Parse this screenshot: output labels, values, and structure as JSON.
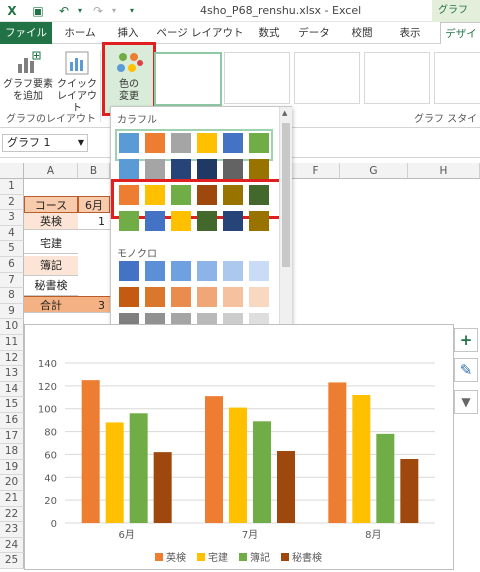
{
  "window": {
    "title": "4sho_P68_renshu.xlsx - Excel",
    "context_tab_group": "グラフ"
  },
  "tabs": [
    "ファイル",
    "ホーム",
    "挿入",
    "ページ レイアウト",
    "数式",
    "データ",
    "校閲",
    "表示",
    "デザイン"
  ],
  "ribbon": {
    "add_element_label_1": "グラフ要素",
    "add_element_label_2": "を追加",
    "quick_layout_label_1": "クイック",
    "quick_layout_label_2": "レイアウト",
    "change_colors_label_1": "色の",
    "change_colors_label_2": "変更",
    "group_layout": "グラフのレイアウト",
    "group_style": "グラフ スタイル"
  },
  "name_box": {
    "value": "グラフ 1"
  },
  "columns": [
    "A",
    "B",
    "F",
    "G",
    "H"
  ],
  "rows": [
    "1",
    "2",
    "3",
    "4",
    "5",
    "6",
    "7",
    "8",
    "9",
    "10",
    "11",
    "12",
    "13",
    "14",
    "15",
    "16",
    "17",
    "18",
    "19",
    "20",
    "21",
    "22",
    "23",
    "24",
    "25"
  ],
  "table": {
    "header": [
      "コース",
      "6月"
    ],
    "labels": [
      "英検",
      "宅建",
      "簿記",
      "秘書検",
      "合計"
    ],
    "partial_b": [
      "1",
      "",
      "",
      "",
      "3"
    ]
  },
  "dropdown": {
    "section_colorful": "カラフル",
    "section_mono": "モノクロ",
    "colorful_rows": [
      [
        "#5b9bd5",
        "#ed7d31",
        "#a5a5a5",
        "#ffc000",
        "#4472c4",
        "#70ad47"
      ],
      [
        "#5b9bd5",
        "#a5a5a5",
        "#264478",
        "#1f3864",
        "#636363",
        "#997300"
      ],
      [
        "#ed7d31",
        "#ffc000",
        "#70ad47",
        "#9e480e",
        "#997300",
        "#43682b"
      ],
      [
        "#70ad47",
        "#4472c4",
        "#ffc000",
        "#43682b",
        "#264478",
        "#997300"
      ]
    ],
    "mono_rows": [
      [
        "#4472c4",
        "#5b8fd6",
        "#6fa1e0",
        "#8db4e8",
        "#adc8ef",
        "#cadbf5"
      ],
      [
        "#c55a11",
        "#d9772d",
        "#e88d4f",
        "#f0a677",
        "#f6c19f",
        "#f9d8c2"
      ],
      [
        "#7f7f7f",
        "#919191",
        "#a5a5a5",
        "#b9b9b9",
        "#cccccc",
        "#dedede"
      ],
      [
        "#d39a00",
        "#e5ad17",
        "#f2be3b",
        "#f7ce6a",
        "#f9dd98",
        "#fce9c0"
      ],
      [
        "#2f5597",
        "#3b68b5",
        "#4d7ecb",
        "#6e97d6",
        "#95b4e2",
        "#bccfee"
      ]
    ]
  },
  "chart_data": {
    "type": "bar",
    "categories": [
      "6月",
      "7月",
      "8月"
    ],
    "series": [
      {
        "name": "英検",
        "color": "#ed7d31",
        "values": [
          125,
          111,
          123
        ]
      },
      {
        "name": "宅建",
        "color": "#ffc000",
        "values": [
          88,
          101,
          112
        ]
      },
      {
        "name": "簿記",
        "color": "#70ad47",
        "values": [
          96,
          89,
          78
        ]
      },
      {
        "name": "秘書検",
        "color": "#9e480e",
        "values": [
          62,
          63,
          56
        ]
      }
    ],
    "yticks": [
      "0",
      "20",
      "40",
      "60",
      "80",
      "100",
      "120",
      "140"
    ],
    "ylim": [
      0,
      140
    ],
    "legend": "bottom",
    "grid": true
  },
  "side_buttons": [
    {
      "name": "chart-elements-button",
      "glyph": "+"
    },
    {
      "name": "chart-styles-button",
      "glyph": "✎"
    },
    {
      "name": "chart-filters-button",
      "glyph": "▼"
    }
  ]
}
